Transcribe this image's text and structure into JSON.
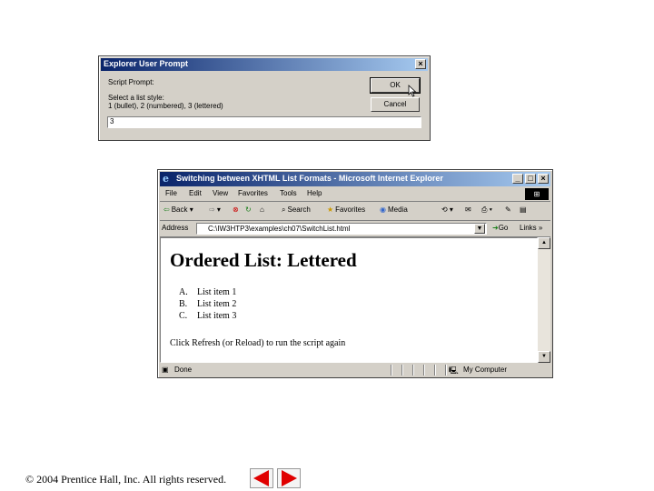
{
  "dialog": {
    "title": "Explorer User Prompt",
    "script_prompt_label": "Script Prompt:",
    "message_line1": "Select a list style:",
    "message_line2": "1 (bullet), 2 (numbered), 3 (lettered)",
    "ok_label": "OK",
    "cancel_label": "Cancel",
    "input_value": "3",
    "close_glyph": "×"
  },
  "browser": {
    "title": "Switching between XHTML List Formats - Microsoft Internet Explorer",
    "window_buttons": [
      "_",
      "□",
      "×"
    ],
    "menu": [
      "File",
      "Edit",
      "View",
      "Favorites",
      "Tools",
      "Help"
    ],
    "toolbar": {
      "back": "Back",
      "search": "Search",
      "favorites": "Favorites",
      "media": "Media"
    },
    "address_label": "Address",
    "address_value": "C:\\IW3HTP3\\examples\\ch07\\SwitchList.html",
    "go_label": "Go",
    "links_label": "Links",
    "status_text": "Done",
    "zone_text": "My Computer"
  },
  "page": {
    "heading": "Ordered List: Lettered",
    "items": [
      {
        "marker": "A.",
        "text": "List item 1"
      },
      {
        "marker": "B.",
        "text": "List item 2"
      },
      {
        "marker": "C.",
        "text": "List item 3"
      }
    ],
    "footer_note": "Click Refresh (or Reload) to run the script again"
  },
  "slide": {
    "copyright": "© 2004 Prentice Hall, Inc.  All rights reserved.",
    "nav_color": "#e00000"
  }
}
